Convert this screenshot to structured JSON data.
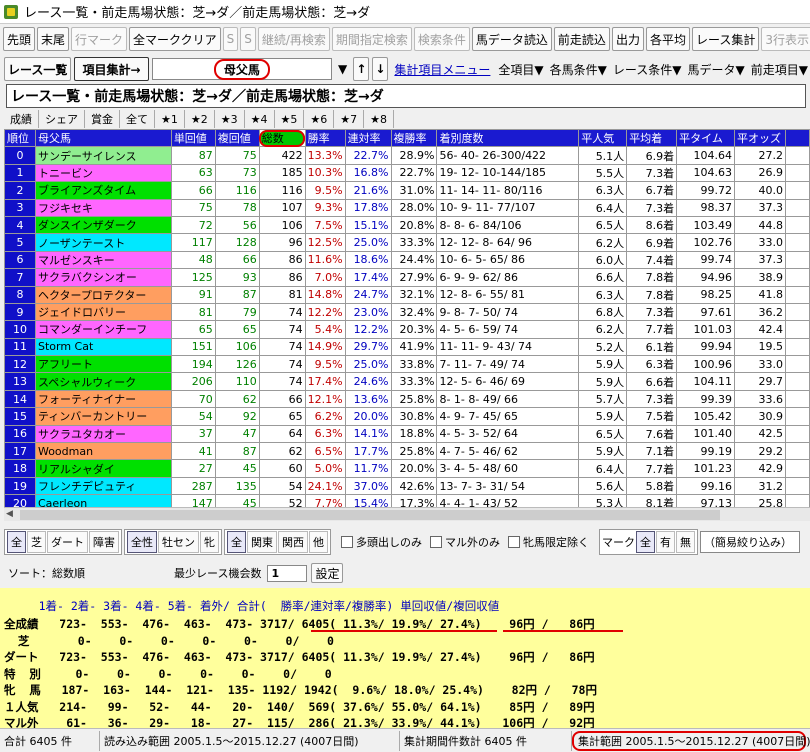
{
  "window": {
    "title": "レース一覧・前走馬場状態：芝→ダ／前走馬場状態：芝→ダ"
  },
  "toolbar": [
    "先頭",
    "末尾",
    "行マーク",
    "全マーククリア",
    "S",
    "S",
    "継続/再検索",
    "期間指定検索",
    "検索条件",
    "馬データ読込",
    "前走読込",
    "出力",
    "各平均",
    "レース集計",
    "3行表示"
  ],
  "toolbar_disabled": [
    false,
    false,
    true,
    false,
    true,
    true,
    true,
    true,
    true,
    false,
    false,
    false,
    false,
    false,
    true
  ],
  "row2": {
    "race_list": "レース一覧",
    "item_agg": "項目集計→",
    "combo_value": "母父馬",
    "sort_up": "↑",
    "sort_down": "↓",
    "menu_link": "集計項目メニュー",
    "menus": [
      "全項目▼",
      "各馬条件▼",
      "レース条件▼",
      "馬データ▼",
      "前走項目▼"
    ]
  },
  "heading": "レース一覧・前走馬場状態：芝→ダ／前走馬場状態：芝→ダ",
  "tabs": [
    "成績",
    "シェア",
    "賞金",
    "全て",
    "★1",
    "★2",
    "★3",
    "★4",
    "★5",
    "★6",
    "★7",
    "★8"
  ],
  "columns": [
    "順位",
    "母父馬",
    "単回値",
    "複回値",
    "総数",
    "勝率",
    "連対率",
    "複勝率",
    "着別度数",
    "平人気",
    "平均着",
    "平タイム",
    "平オッズ"
  ],
  "rows": [
    [
      "0",
      "サンデーサイレンス",
      "87",
      "75",
      "422",
      "13.3%",
      "22.7%",
      "28.9%",
      "56- 40- 26-300/422",
      "5.1人",
      "6.9着",
      "104.64",
      "27.2"
    ],
    [
      "1",
      "トニービン",
      "63",
      "73",
      "185",
      "10.3%",
      "16.8%",
      "22.7%",
      "19- 12- 10-144/185",
      "5.5人",
      "7.3着",
      "104.63",
      "26.9"
    ],
    [
      "2",
      "ブライアンズタイム",
      "66",
      "116",
      "116",
      "9.5%",
      "21.6%",
      "31.0%",
      "11- 14- 11- 80/116",
      "6.3人",
      "6.7着",
      "99.72",
      "40.0"
    ],
    [
      "3",
      "フジキセキ",
      "75",
      "78",
      "107",
      "9.3%",
      "17.8%",
      "28.0%",
      "10-  9- 11- 77/107",
      "6.4人",
      "7.3着",
      "98.37",
      "37.3"
    ],
    [
      "4",
      "ダンスインザダーク",
      "72",
      "56",
      "106",
      "7.5%",
      "15.1%",
      "20.8%",
      "8-  8-  6- 84/106",
      "6.5人",
      "8.6着",
      "103.49",
      "44.8"
    ],
    [
      "5",
      "ノーザンテースト",
      "117",
      "128",
      "96",
      "12.5%",
      "25.0%",
      "33.3%",
      "12- 12-  8- 64/ 96",
      "6.2人",
      "6.9着",
      "102.76",
      "33.0"
    ],
    [
      "6",
      "マルゼンスキー",
      "48",
      "66",
      "86",
      "11.6%",
      "18.6%",
      "24.4%",
      "10-  6-  5- 65/ 86",
      "6.0人",
      "7.4着",
      "99.74",
      "37.3"
    ],
    [
      "7",
      "サクラバクシンオー",
      "125",
      "93",
      "86",
      "7.0%",
      "17.4%",
      "27.9%",
      "6-  9-  9- 62/ 86",
      "6.6人",
      "7.8着",
      "94.96",
      "38.9"
    ],
    [
      "8",
      "ヘクタープロテクター",
      "91",
      "87",
      "81",
      "14.8%",
      "24.7%",
      "32.1%",
      "12-  8-  6- 55/ 81",
      "6.3人",
      "7.8着",
      "98.25",
      "41.8"
    ],
    [
      "9",
      "ジェイドロバリー",
      "81",
      "79",
      "74",
      "12.2%",
      "23.0%",
      "32.4%",
      "9-  8-  7- 50/ 74",
      "6.8人",
      "7.3着",
      "97.61",
      "36.2"
    ],
    [
      "10",
      "コマンダーインチーフ",
      "65",
      "65",
      "74",
      "5.4%",
      "12.2%",
      "20.3%",
      "4-  5-  6- 59/ 74",
      "6.2人",
      "7.7着",
      "101.03",
      "42.4"
    ],
    [
      "11",
      "Storm Cat",
      "151",
      "106",
      "74",
      "14.9%",
      "29.7%",
      "41.9%",
      "11- 11-  9- 43/ 74",
      "5.2人",
      "6.1着",
      "99.94",
      "19.5"
    ],
    [
      "12",
      "アフリート",
      "194",
      "126",
      "74",
      "9.5%",
      "25.0%",
      "33.8%",
      "7- 11-  7- 49/ 74",
      "5.9人",
      "6.3着",
      "100.96",
      "33.0"
    ],
    [
      "13",
      "スペシャルウィーク",
      "206",
      "110",
      "74",
      "17.4%",
      "24.6%",
      "33.3%",
      "12-  5-  6- 46/ 69",
      "5.9人",
      "6.6着",
      "104.11",
      "29.7"
    ],
    [
      "14",
      "フォーティナイナー",
      "70",
      "62",
      "66",
      "12.1%",
      "13.6%",
      "25.8%",
      "8-  1-  8- 49/ 66",
      "5.7人",
      "7.3着",
      "99.39",
      "33.6"
    ],
    [
      "15",
      "ティンバーカントリー",
      "54",
      "92",
      "65",
      "6.2%",
      "20.0%",
      "30.8%",
      "4-  9-  7- 45/ 65",
      "5.9人",
      "7.5着",
      "105.42",
      "30.9"
    ],
    [
      "16",
      "サクラユタカオー",
      "37",
      "47",
      "64",
      "6.3%",
      "14.1%",
      "18.8%",
      "4-  5-  3- 52/ 64",
      "6.5人",
      "7.6着",
      "101.40",
      "42.5"
    ],
    [
      "17",
      "Woodman",
      "41",
      "87",
      "62",
      "6.5%",
      "17.7%",
      "25.8%",
      "4-  7-  5- 46/ 62",
      "5.9人",
      "7.1着",
      "99.19",
      "29.2"
    ],
    [
      "18",
      "リアルシャダイ",
      "27",
      "45",
      "60",
      "5.0%",
      "11.7%",
      "20.0%",
      "3-  4-  5- 48/ 60",
      "6.4人",
      "7.7着",
      "101.23",
      "42.9"
    ],
    [
      "19",
      "フレンチデピュティ",
      "287",
      "135",
      "54",
      "24.1%",
      "37.0%",
      "42.6%",
      "13-  7-  3- 31/ 54",
      "5.6人",
      "5.8着",
      "99.16",
      "31.2"
    ],
    [
      "20",
      "Caerleon",
      "147",
      "45",
      "52",
      "7.7%",
      "15.4%",
      "17.3%",
      "4-  4-  1- 43/ 52",
      "5.3人",
      "8.1着",
      "97.13",
      "25.8"
    ]
  ],
  "row_colors": [
    "#90ee90",
    "#ff66ff",
    "#00e000",
    "#ff66ff",
    "#00e000",
    "#00e8ff",
    "#ff66ff",
    "#ff66ff",
    "#ff9e60",
    "#ff9e60",
    "#ff66ff",
    "#00e8ff",
    "#00e000",
    "#00e000",
    "#ff9e60",
    "#ff9e60",
    "#ff66ff",
    "#ff9e60",
    "#00e000",
    "#00e8ff",
    "#00e8ff"
  ],
  "filters": {
    "surface": [
      "全",
      "芝",
      "ダート",
      "障害"
    ],
    "sex": [
      "全性",
      "牡セン",
      "牝"
    ],
    "region": [
      "全",
      "関東",
      "関西",
      "他"
    ],
    "checks": [
      "多頭出しのみ",
      "マル外のみ",
      "牝馬限定除く"
    ],
    "mark_label": "マーク",
    "mark": [
      "全",
      "有",
      "無"
    ],
    "narrow": "（簡易絞り込み）"
  },
  "sort": {
    "label": "ソート：総数順",
    "min_label": "最少レース機会数",
    "min_value": "1",
    "set": "設定"
  },
  "summary": {
    "header": "     1着- 2着- 3着- 4着- 5着- 着外/ 合計(  勝率/連対率/複勝率) 単回収値/複回収値",
    "lines": [
      "全成績   723-  553-  476-  463-  473- 3717/ 6405( 11.3%/ 19.9%/ 27.4%)    96円 /   86円",
      "  芝       0-    0-    0-    0-    0-    0/    0",
      "ダート   723-  553-  476-  463-  473- 3717/ 6405( 11.3%/ 19.9%/ 27.4%)    96円 /   86円",
      "特  別     0-    0-    0-    0-    0-    0/    0",
      "牝  馬   187-  163-  144-  121-  135- 1192/ 1942(  9.6%/ 18.0%/ 25.4%)    82円 /   78円",
      "１人気   214-   99-   52-   44-   20-  140/  569( 37.6%/ 55.0%/ 64.1%)    85円 /   89円",
      "マル外    61-   36-   29-   18-   27-  115/  286( 21.3%/ 33.9%/ 44.1%)   106円 /   92円"
    ]
  },
  "status": {
    "total": "合計 6405 件",
    "read_range": "読み込み範囲 2005.1.5～2015.12.27 (4007日間)",
    "period_count": "集計期間件数計 6405 件",
    "agg_range": "集計範囲 2005.1.5～2015.12.27 (4007日間)"
  }
}
